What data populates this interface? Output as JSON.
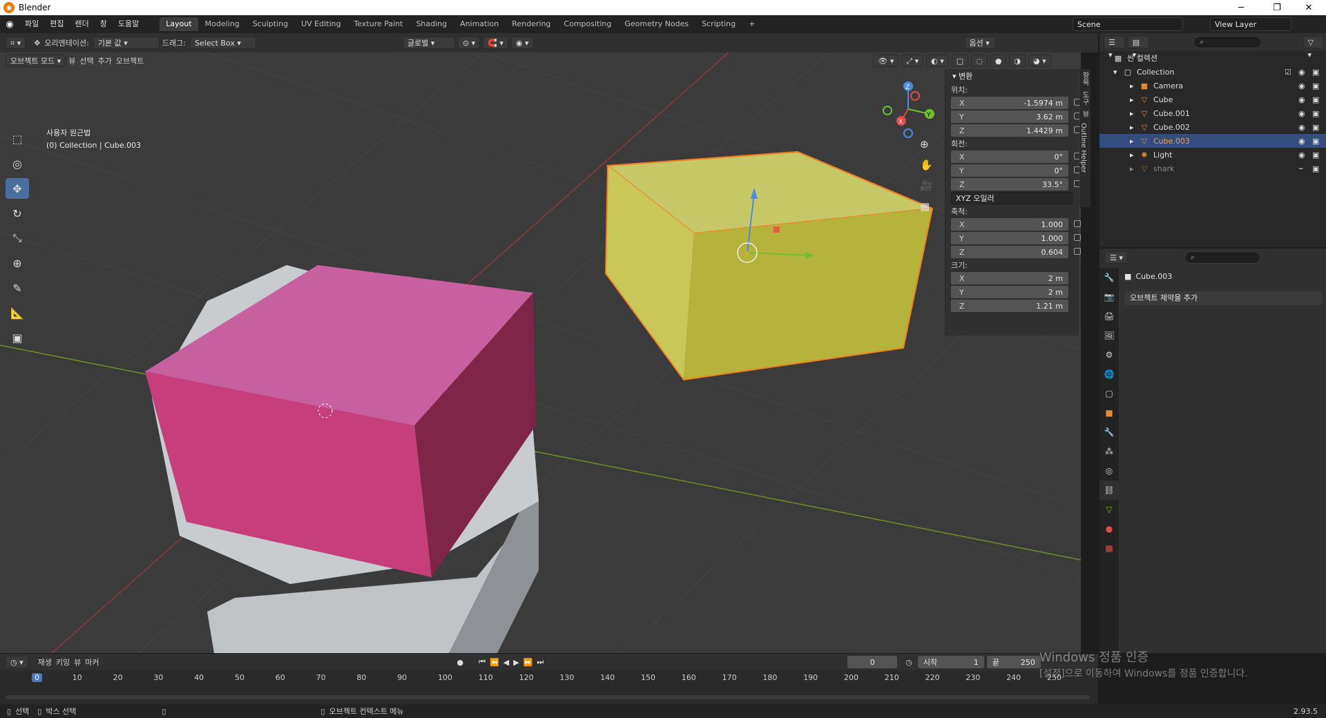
{
  "window": {
    "title": "Blender",
    "minimize": "─",
    "restore": "❐",
    "close": "✕"
  },
  "menu": [
    "파일",
    "편집",
    "렌더",
    "창",
    "도움말"
  ],
  "workspaces": [
    "Layout",
    "Modeling",
    "Sculpting",
    "UV Editing",
    "Texture Paint",
    "Shading",
    "Animation",
    "Rendering",
    "Compositing",
    "Geometry Nodes",
    "Scripting"
  ],
  "add_workspace": "+",
  "scene": "Scene",
  "view_layer": "View Layer",
  "viewport_header": {
    "orientation_label": "오리엔테이션:",
    "orientation_value": "기본 값",
    "drag_label": "드래그:",
    "drag_value": "Select Box",
    "transform_pivot": "글로벌",
    "options": "옵션"
  },
  "viewport_header2": {
    "mode": "오브젝트 모드",
    "items": [
      "뷰",
      "선택",
      "추가",
      "오브젝트"
    ]
  },
  "viewport_info": {
    "view_name": "사용자 원근법",
    "collection": "(0) Collection | Cube.003"
  },
  "npanel": {
    "section": "변환",
    "location_label": "위치:",
    "location": [
      {
        "axis": "X",
        "value": "-1.5974 m"
      },
      {
        "axis": "Y",
        "value": "3.62 m"
      },
      {
        "axis": "Z",
        "value": "1.4429 m"
      }
    ],
    "rotation_label": "회전:",
    "rotation": [
      {
        "axis": "X",
        "value": "0°"
      },
      {
        "axis": "Y",
        "value": "0°"
      },
      {
        "axis": "Z",
        "value": "33.5°"
      }
    ],
    "rotation_mode": "XYZ 오일러",
    "scale_label": "축척:",
    "scale": [
      {
        "axis": "X",
        "value": "1.000"
      },
      {
        "axis": "Y",
        "value": "1.000"
      },
      {
        "axis": "Z",
        "value": "0.604"
      }
    ],
    "dimensions_label": "크기:",
    "dimensions": [
      {
        "axis": "X",
        "value": "2 m"
      },
      {
        "axis": "Y",
        "value": "2 m"
      },
      {
        "axis": "Z",
        "value": "1.21 m"
      }
    ],
    "side_tabs": [
      "항목",
      "도구",
      "뷰",
      "Outline Helper"
    ]
  },
  "outliner": {
    "scene_collection": "씬 컬렉션",
    "items": [
      {
        "name": "Collection",
        "level": 1,
        "icon": "collection-icon"
      },
      {
        "name": "Camera",
        "level": 2,
        "icon": "camera-icon"
      },
      {
        "name": "Cube",
        "level": 2,
        "icon": "mesh-icon"
      },
      {
        "name": "Cube.001",
        "level": 2,
        "icon": "mesh-icon"
      },
      {
        "name": "Cube.002",
        "level": 2,
        "icon": "mesh-icon"
      },
      {
        "name": "Cube.003",
        "level": 2,
        "icon": "mesh-icon",
        "selected": true
      },
      {
        "name": "Light",
        "level": 2,
        "icon": "light-icon"
      },
      {
        "name": "shark",
        "level": 2,
        "icon": "mesh-icon",
        "dim": true
      }
    ]
  },
  "properties": {
    "object_name": "Cube.003",
    "add_constraint": "오브젝트 제약을 추가"
  },
  "timeline": {
    "menu": [
      "재생",
      "키잉",
      "뷰",
      "마커"
    ],
    "current_frame": "0",
    "start_label": "시작",
    "start": "1",
    "end_label": "끝",
    "end": "250",
    "ruler": [
      "0",
      "10",
      "20",
      "30",
      "40",
      "50",
      "60",
      "70",
      "80",
      "90",
      "100",
      "110",
      "120",
      "130",
      "140",
      "150",
      "160",
      "170",
      "180",
      "190",
      "200",
      "210",
      "220",
      "230",
      "240",
      "250"
    ]
  },
  "statusbar": {
    "select": "선택",
    "box_select": "박스 선택",
    "context_menu": "오브젝트 컨텍스트 메뉴",
    "version": "2.93.5"
  },
  "watermark": {
    "line1": "Windows 정품 인증",
    "line2": "[설정]으로 이동하여 Windows를 정품 인증합니다."
  }
}
